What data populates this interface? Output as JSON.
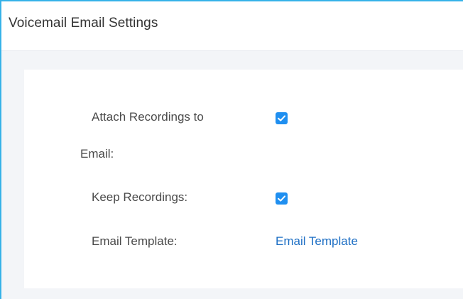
{
  "header": {
    "title": "Voicemail Email Settings"
  },
  "form": {
    "attach_recordings": {
      "label_line1": "Attach Recordings to",
      "label_line2": "Email:",
      "checked": true
    },
    "keep_recordings": {
      "label": "Keep Recordings:",
      "checked": true
    },
    "email_template": {
      "label": "Email Template:",
      "link_text": "Email Template"
    }
  },
  "colors": {
    "frame_border": "#36b2e8",
    "checkbox_fill": "#1f8ff0",
    "link": "#1e6fc4",
    "panel_background": "#f3f5f8"
  },
  "icons": {
    "checkbox": "check-icon"
  }
}
